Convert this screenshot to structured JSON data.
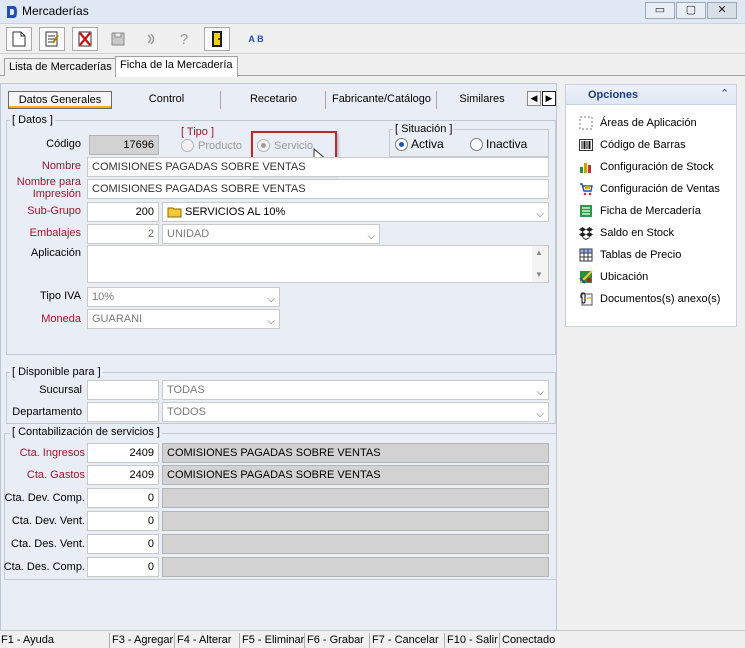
{
  "window": {
    "title": "Mercaderías",
    "min_glyph": "▭",
    "max_glyph": "▢",
    "close_glyph": "✕"
  },
  "toolbar": {
    "buttons": [
      {
        "name": "new-document-icon"
      },
      {
        "name": "edit-document-icon"
      },
      {
        "name": "delete-icon"
      },
      {
        "name": "save-icon"
      },
      {
        "name": "refresh-icon"
      },
      {
        "name": "help-icon"
      },
      {
        "name": "exit-icon"
      },
      {
        "name": "spellcheck-icon"
      }
    ],
    "help_glyph": "?",
    "spell_glyph": "A B"
  },
  "main_tabs": [
    "Lista de Mercaderías",
    "Ficha de la Mercadería"
  ],
  "sub_tabs": [
    "Datos Generales",
    "Control",
    "Recetario",
    "Fabricante/Catálogo",
    "Similares"
  ],
  "datos": {
    "group_title": "[ Datos ]",
    "codigo_label": "Código",
    "codigo_value": "17696",
    "tipo_title": "[ Tipo ]",
    "tipo_producto": "Producto",
    "tipo_servicio": "Servicio",
    "situacion_title": "[ Situación ]",
    "situacion_activa": "Activa",
    "situacion_inactiva": "Inactiva",
    "nombre_label": "Nombre",
    "nombre_value": "COMISIONES PAGADAS SOBRE VENTAS",
    "nombre_impresion_label_1": "Nombre para",
    "nombre_impresion_label_2": "Impresión",
    "nombre_impresion_value": "COMISIONES PAGADAS SOBRE VENTAS",
    "subgrupo_label": "Sub-Grupo",
    "subgrupo_code": "200",
    "subgrupo_value": "SERVICIOS AL 10%",
    "embalajes_label": "Embalajes",
    "embalajes_code": "2",
    "embalajes_value": "UNIDAD",
    "aplicacion_label": "Aplicación",
    "aplicacion_value": "",
    "tipo_iva_label": "Tipo IVA",
    "tipo_iva_value": "10%",
    "moneda_label": "Moneda",
    "moneda_value": "GUARANI"
  },
  "disponible": {
    "group_title": "[ Disponible para ]",
    "sucursal_label": "Sucursal",
    "sucursal_value": "TODAS",
    "departamento_label": "Departamento",
    "departamento_value": "TODOS"
  },
  "contabilizacion": {
    "group_title": "[ Contabilización de servicios ]",
    "rows": [
      {
        "label": "Cta. Ingresos",
        "code": "2409",
        "desc": "COMISIONES PAGADAS SOBRE VENTAS",
        "required": true
      },
      {
        "label": "Cta. Gastos",
        "code": "2409",
        "desc": "COMISIONES PAGADAS SOBRE VENTAS",
        "required": true
      },
      {
        "label": "Cta. Dev. Comp.",
        "code": "0",
        "desc": "",
        "required": false
      },
      {
        "label": "Cta. Dev. Vent.",
        "code": "0",
        "desc": "",
        "required": false
      },
      {
        "label": "Cta. Des. Vent.",
        "code": "0",
        "desc": "",
        "required": false
      },
      {
        "label": "Cta. Des. Comp.",
        "code": "0",
        "desc": "",
        "required": false
      }
    ]
  },
  "opciones": {
    "title": "Opciones",
    "collapse_glyph": "⌃",
    "items": [
      {
        "label": "Áreas de Aplicación",
        "icon": "dotted-square-icon"
      },
      {
        "label": "Código de Barras",
        "icon": "barcode-icon"
      },
      {
        "label": "Configuración de Stock",
        "icon": "chart-icon"
      },
      {
        "label": "Configuración de Ventas",
        "icon": "cart-icon"
      },
      {
        "label": "Ficha de Mercadería",
        "icon": "list-icon"
      },
      {
        "label": "Saldo en Stock",
        "icon": "dropbox-icon"
      },
      {
        "label": "Tablas de Precio",
        "icon": "price-table-icon"
      },
      {
        "label": "Ubicación",
        "icon": "map-icon"
      },
      {
        "label": "Documentos(s) anexo(s)",
        "icon": "attachment-icon"
      }
    ]
  },
  "statusbar": [
    "F1 - Ayuda",
    "F3 - Agregar",
    "F4 - Alterar",
    "F5 - Eliminar",
    "F6 - Grabar",
    "F7 - Cancelar",
    "F10 - Salir",
    "Conectado"
  ],
  "colors": {
    "accent_red": "#a0142c",
    "highlight_box": "#c0282c",
    "panel_bg": "#e9eef6",
    "tab_underline": "#f2b400"
  }
}
